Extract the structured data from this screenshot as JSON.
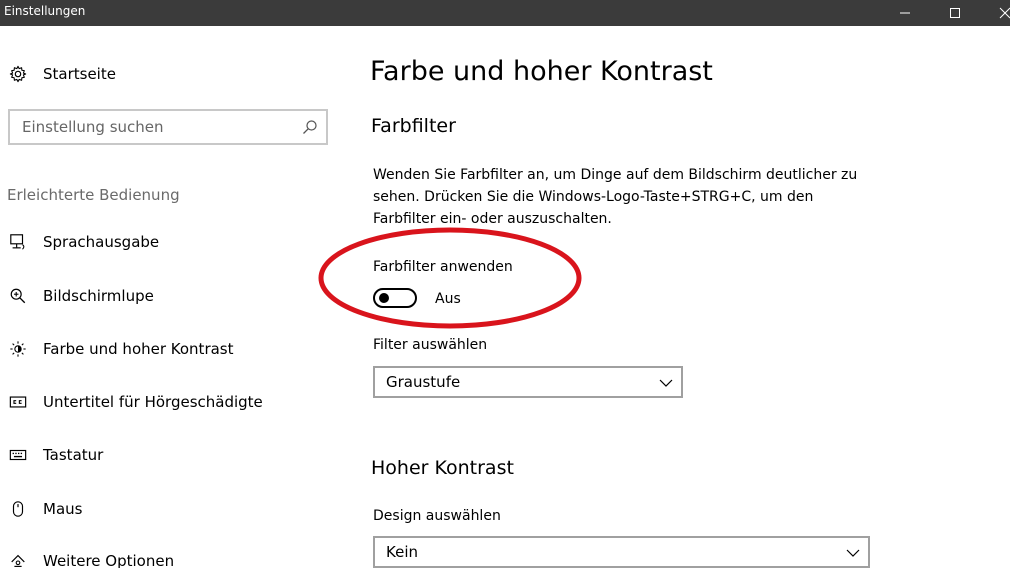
{
  "window": {
    "title": "Einstellungen"
  },
  "sidebar": {
    "home_label": "Startseite",
    "search": {
      "placeholder": "Einstellung suchen",
      "value": ""
    },
    "section_label": "Erleichterte Bedienung",
    "items": [
      {
        "label": "Sprachausgabe",
        "icon": "narrator-icon"
      },
      {
        "label": "Bildschirmlupe",
        "icon": "magnifier-icon"
      },
      {
        "label": "Farbe und hoher Kontrast",
        "icon": "brightness-icon"
      },
      {
        "label": "Untertitel für Hörgeschädigte",
        "icon": "closed-caption-icon"
      },
      {
        "label": "Tastatur",
        "icon": "keyboard-icon"
      },
      {
        "label": "Maus",
        "icon": "mouse-icon"
      },
      {
        "label": "Weitere Optionen",
        "icon": "more-options-icon"
      }
    ]
  },
  "main": {
    "title": "Farbe und hoher Kontrast",
    "color_filter": {
      "heading": "Farbfilter",
      "description": "Wenden Sie Farbfilter an, um Dinge auf dem Bildschirm deutlicher zu sehen. Drücken Sie die Windows-Logo-Taste+STRG+C, um den Farbfilter ein- oder auszuschalten.",
      "toggle_label": "Farbfilter anwenden",
      "toggle_state": "Aus",
      "toggle_on": false,
      "select_label": "Filter auswählen",
      "select_value": "Graustufe"
    },
    "high_contrast": {
      "heading": "Hoher Kontrast",
      "select_label": "Design auswählen",
      "select_value": "Kein"
    }
  },
  "colors": {
    "titlebar": "#3b3b3b",
    "highlight": "#d9141c"
  }
}
